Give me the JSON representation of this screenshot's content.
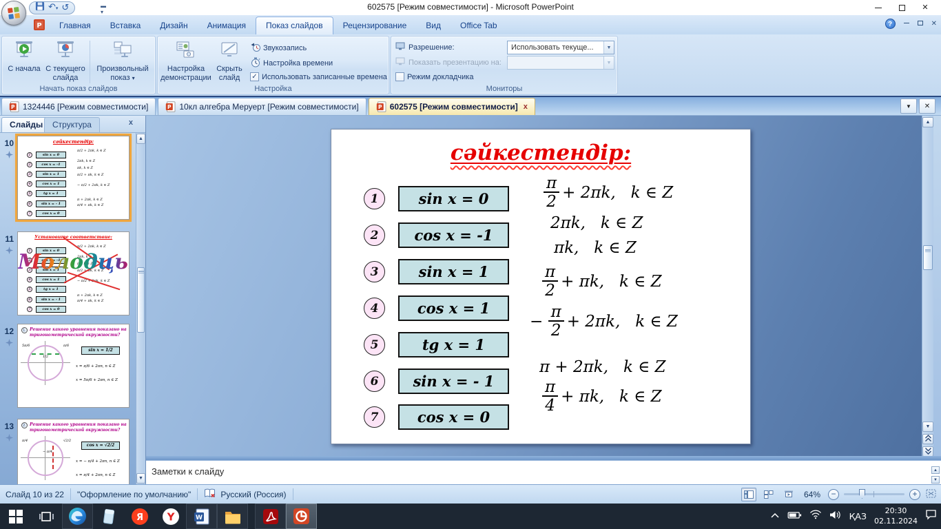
{
  "window": {
    "title": "602575 [Режим совместимости] - Microsoft PowerPoint"
  },
  "qat": {
    "icons": [
      "save",
      "undo",
      "redo"
    ]
  },
  "ribbon": {
    "tabs": [
      "Главная",
      "Вставка",
      "Дизайн",
      "Анимация",
      "Показ слайдов",
      "Рецензирование",
      "Вид",
      "Office Tab"
    ],
    "active_tab": "Показ слайдов",
    "start_group": {
      "label": "Начать показ слайдов",
      "from_beginning": "С начала",
      "from_current": "С текущего слайда",
      "custom_show": "Произвольный показ"
    },
    "setup_group": {
      "label": "Настройка",
      "setup_btn": "Настройка демонстрации",
      "hide_btn": "Скрыть слайд",
      "record": "Звукозапись",
      "timing": "Настройка времени",
      "use_timings": "Использовать записанные времена"
    },
    "monitors_group": {
      "label": "Мониторы",
      "resolution_label": "Разрешение:",
      "resolution_value": "Использовать текуще...",
      "show_on_label": "Показать презентацию на:",
      "presenter_label": "Режим докладчика"
    }
  },
  "doc_tabs": {
    "tabs": [
      {
        "label": "1324446 [Режим совместимости]",
        "active": false
      },
      {
        "label": "10кл алгебра Меруерт [Режим совместимости]",
        "active": false
      },
      {
        "label": "602575 [Режим совместимости]",
        "active": true,
        "close": "x"
      }
    ]
  },
  "slides_panel": {
    "slides_tab": "Слайды",
    "outline_tab": "Структура",
    "close": "x",
    "thumbnails": [
      {
        "number": "10",
        "kind": "match",
        "selected": true,
        "title": "сәйкестендір:"
      },
      {
        "number": "11",
        "kind": "celebrate",
        "selected": false,
        "title": "Установите соответствие:",
        "overlay": "Молодцы!"
      },
      {
        "number": "12",
        "kind": "circle",
        "selected": false,
        "badge": "1.",
        "title": "Решение какого уравнения показано на тригонометрической окружности?",
        "eq": "sin x = 1/2",
        "labels": [
          "5π/6",
          "π/6",
          "1/2"
        ],
        "solutions": [
          "x = π/6 + 2πn, n ∈ Z",
          "x = 5π/6 + 2πn, n ∈ Z"
        ],
        "dash_color": "#2fa04a"
      },
      {
        "number": "13",
        "kind": "circle",
        "selected": false,
        "badge": "2.",
        "title": "Решение какого уравнения показано на тригонометрической окружности?",
        "eq": "cos x = √2/2",
        "labels": [
          "π/4",
          "√2/2",
          "− π/4"
        ],
        "solutions": [
          "x = − π/4 + 2πn, n ∈ Z",
          "x = π/4 + 2πn, n ∈ Z"
        ],
        "dash_color": "#d03030"
      }
    ]
  },
  "slide": {
    "title": "сәйкестендір:",
    "title_color": "#e60000",
    "box_fill": "#c5e1e5",
    "circle_fill": "#fce4f6",
    "items": [
      {
        "n": "1",
        "eq": "sin x = 0"
      },
      {
        "n": "2",
        "eq": "cos x = -1"
      },
      {
        "n": "3",
        "eq": "sin x = 1"
      },
      {
        "n": "4",
        "eq": "cos x = 1"
      },
      {
        "n": "5",
        "eq": "tg x = 1"
      },
      {
        "n": "6",
        "eq": "sin x = - 1"
      },
      {
        "n": "7",
        "eq": "cos x = 0"
      }
    ],
    "answers": [
      {
        "frac": {
          "num": "π",
          "den": "2"
        },
        "suffix": "+ 2πk,   k ∈ Z"
      },
      {
        "text": "2πk,   k ∈ Z"
      },
      {
        "text": "πk,   k ∈ Z"
      },
      {
        "frac": {
          "num": "π",
          "den": "2"
        },
        "suffix": "+ πk,   k ∈ Z"
      },
      {
        "neg": "− ",
        "frac": {
          "num": "π",
          "den": "2"
        },
        "suffix": "+ 2πk,   k ∈ Z"
      },
      {
        "text": "π + 2πk,   k ∈ Z"
      },
      {
        "frac": {
          "num": "π",
          "den": "4"
        },
        "suffix": "+ πk,   k ∈ Z"
      }
    ]
  },
  "notes": {
    "placeholder": "Заметки к слайду"
  },
  "status_bar": {
    "slide_indicator": "Слайд 10 из 22",
    "theme": "\"Оформление по умолчанию\"",
    "language": "Русский (Россия)",
    "zoom": "64%"
  },
  "taskbar": {
    "apps": [
      {
        "name": "start"
      },
      {
        "name": "task-view"
      },
      {
        "name": "edge",
        "open": true
      },
      {
        "name": "glass-app"
      },
      {
        "name": "yandex"
      },
      {
        "name": "yandex-browser"
      },
      {
        "name": "word",
        "open": true
      },
      {
        "name": "file-explorer",
        "open": true
      },
      {
        "name": "acrobat",
        "open": true
      },
      {
        "name": "powerpoint",
        "open": true,
        "active": true
      }
    ],
    "tray": {
      "language": "ҚАЗ",
      "time": "20:30",
      "date": "02.11.2024"
    }
  }
}
